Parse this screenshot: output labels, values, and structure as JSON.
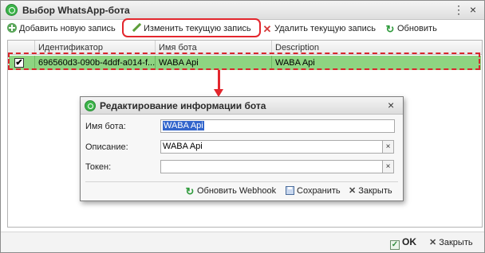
{
  "window": {
    "title": "Выбор WhatsApp-бота",
    "more_glyph": "⋮",
    "close_glyph": "×"
  },
  "toolbar": {
    "add_label": "Добавить новую запись",
    "edit_label": "Изменить текущую запись",
    "delete_label": "Удалить текущую запись",
    "refresh_label": "Обновить"
  },
  "grid": {
    "columns": [
      "Идентификатор",
      "Имя бота",
      "Description"
    ],
    "rows": [
      {
        "checked": "✔",
        "id": "696560d3-090b-4ddf-a014-f...",
        "name": "WABA Api",
        "description": "WABA Api"
      }
    ]
  },
  "dialog": {
    "title": "Редактирование информации бота",
    "close_glyph": "×",
    "fields": {
      "name_label": "Имя бота:",
      "name_value": "WABA Api",
      "description_label": "Описание:",
      "description_value": "WABA Api",
      "token_label": "Токен:",
      "token_value": "",
      "clear_glyph": "×"
    },
    "buttons": {
      "refresh_webhook": "Обновить Webhook",
      "save": "Сохранить",
      "close": "Закрыть"
    }
  },
  "footer": {
    "ok_label": "OK",
    "close_label": "Закрыть"
  },
  "colors": {
    "selected_row": "#8ed481",
    "highlight": "#e3262d",
    "icon_green": "#3cb54a"
  }
}
